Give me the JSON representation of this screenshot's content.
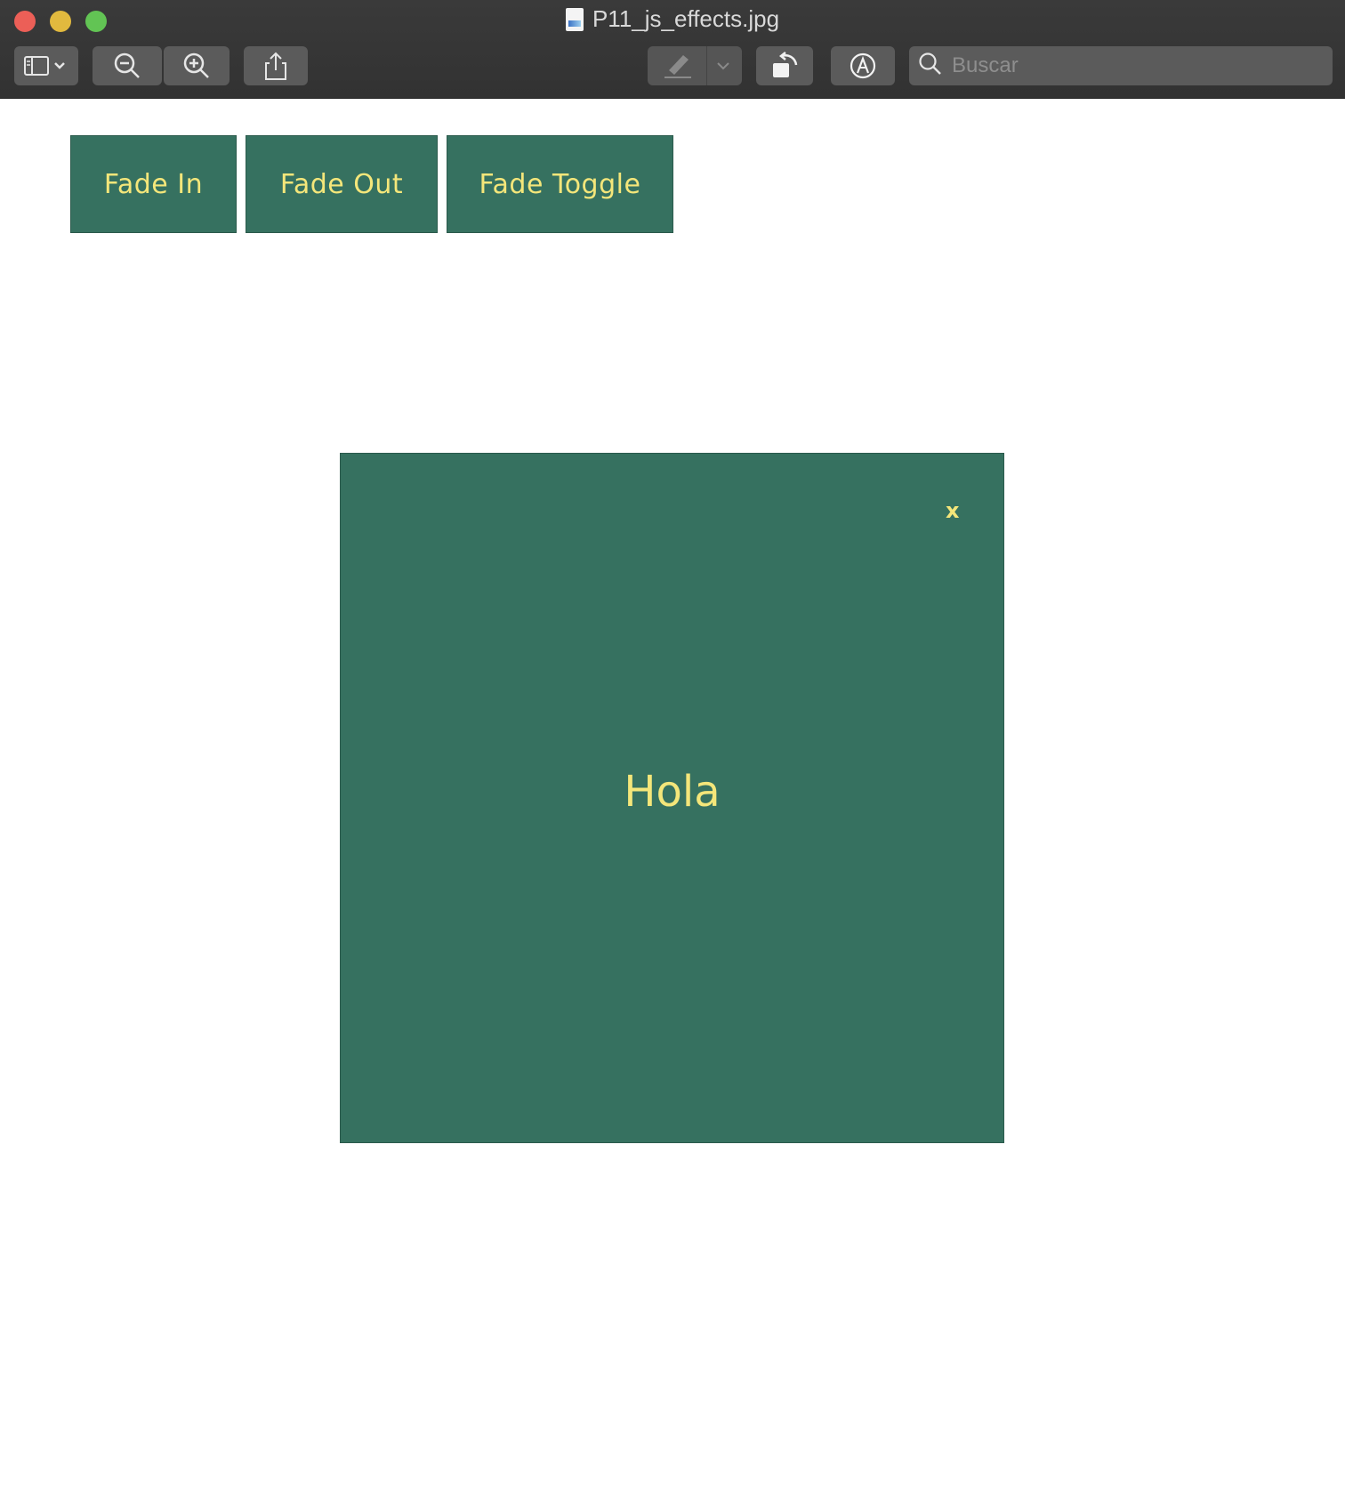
{
  "window": {
    "title": "P11_js_effects.jpg"
  },
  "toolbar": {
    "search_placeholder": "Buscar",
    "icons": [
      "sidebar-toggle-icon",
      "zoom-out-icon",
      "zoom-in-icon",
      "share-icon",
      "highlight-pen-icon",
      "chevron-down-icon",
      "rotate-icon",
      "markup-icon",
      "search-icon"
    ]
  },
  "content": {
    "buttons": {
      "fade_in": "Fade In",
      "fade_out": "Fade Out",
      "fade_toggle": "Fade Toggle"
    },
    "panel": {
      "close_label": "x",
      "text": "Hola"
    }
  },
  "colors": {
    "accent_green": "#367160",
    "accent_yellow": "#f4e67a",
    "toolbar_bg": "#3a3a3a"
  }
}
